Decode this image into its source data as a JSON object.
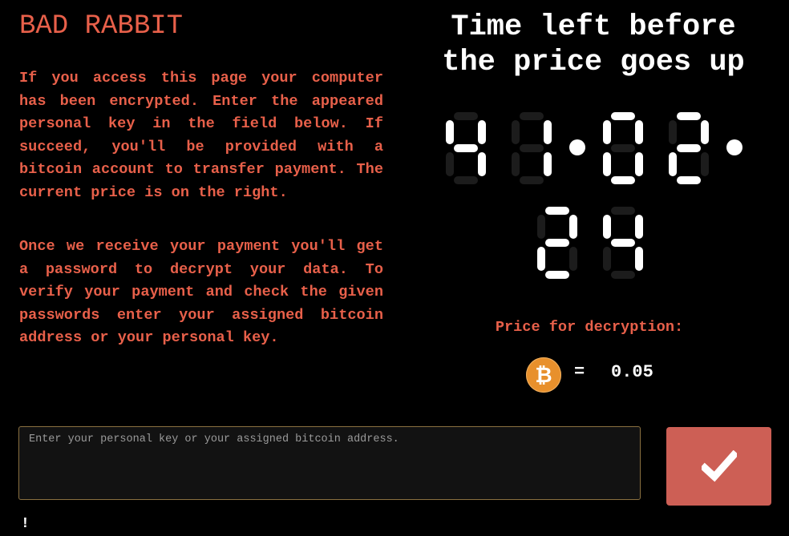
{
  "title": "BAD RABBIT",
  "paragraphs": [
    "If you access this page your computer has been encrypted. Enter the appeared personal key in the field below. If succeed, you'll be provided with a bitcoin account to transfer payment. The current price is on the right.",
    "Once we receive your payment you'll get a password to decrypt your data. To verify your payment and check the given passwords enter your assigned bitcoin address or your personal key."
  ],
  "timer": {
    "title": "Time left before the price goes up",
    "hours": "41",
    "minutes": "02",
    "seconds": "24"
  },
  "price": {
    "label": "Price for decryption:",
    "currency_icon": "bitcoin-icon",
    "currency_symbol": "₿",
    "equals": "=",
    "amount": "0.05"
  },
  "form": {
    "placeholder": "Enter your personal key or your assigned bitcoin address.",
    "value": "",
    "submit_icon": "checkmark-icon"
  },
  "status_text": "!",
  "colors": {
    "accent": "#e8604a",
    "button": "#cd5f55",
    "bitcoin": "#e8902c"
  }
}
